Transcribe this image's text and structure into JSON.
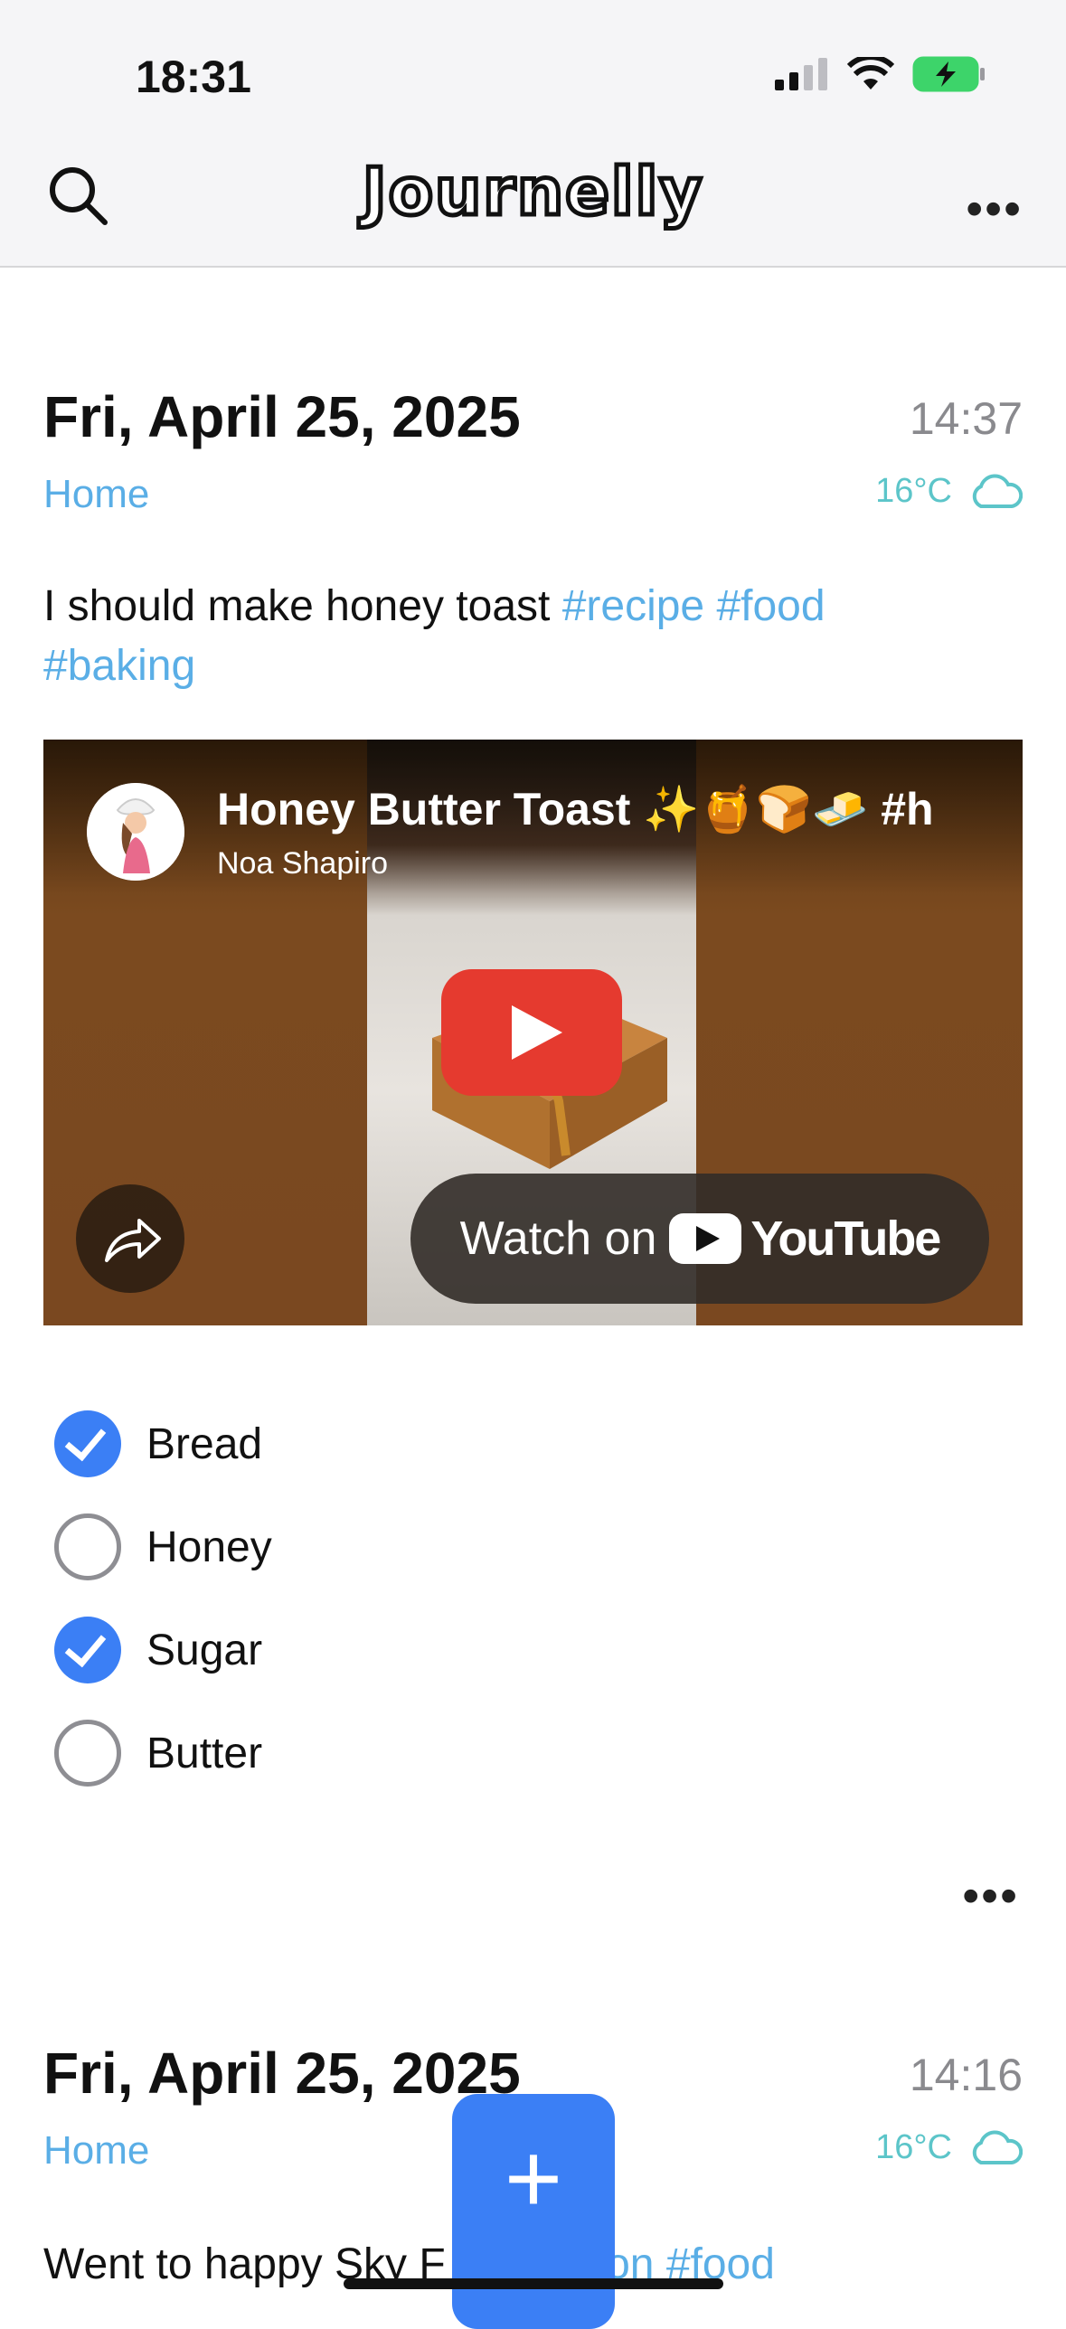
{
  "status": {
    "time": "18:31"
  },
  "header": {
    "app_name": "Journelly"
  },
  "entries": [
    {
      "date": "Fri, April 25, 2025",
      "time": "14:37",
      "place": "Home",
      "temp": "16°C",
      "text_plain": "I should make honey toast ",
      "tags_line1": "#recipe #food",
      "tags_line2": "#baking",
      "video": {
        "title": "Honey Butter Toast ✨🍯🍞🧈 #h",
        "channel": "Noa Shapiro",
        "watch_on": "Watch on",
        "platform": "YouTube"
      },
      "checklist": [
        {
          "label": "Bread",
          "checked": true
        },
        {
          "label": "Honey",
          "checked": false
        },
        {
          "label": "Sugar",
          "checked": true
        },
        {
          "label": "Butter",
          "checked": false
        }
      ]
    },
    {
      "date": "Fri, April 25, 2025",
      "time": "14:16",
      "place": "Home",
      "temp": "16°C",
      "text_plain": "Went to happy Sky F",
      "tags": "#london #food"
    }
  ],
  "fab": {
    "label": "+"
  },
  "colors": {
    "accent": "#3b7ff5",
    "tag": "#5aaee6",
    "weather": "#5cc5c9",
    "play": "#e53a2f"
  },
  "icons": [
    "search-icon",
    "more-icon",
    "cloud-icon",
    "play-icon",
    "share-icon",
    "checkmark-icon",
    "signal-icon",
    "wifi-icon",
    "battery-icon"
  ]
}
